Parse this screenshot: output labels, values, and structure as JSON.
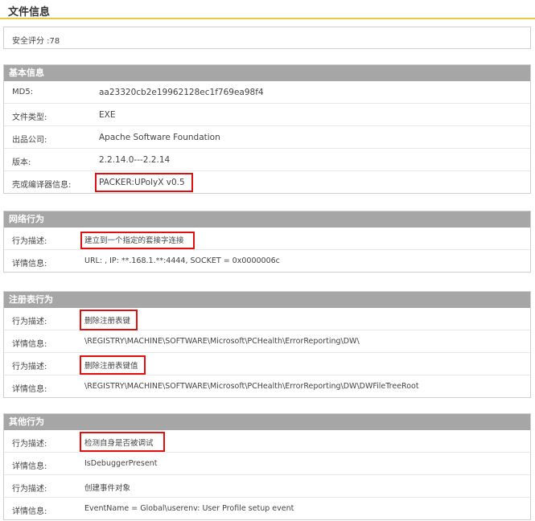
{
  "header": {
    "title": "文件信息"
  },
  "score": {
    "text": "安全评分 :78"
  },
  "basic": {
    "title": "基本信息",
    "rows": [
      {
        "label": "MD5:",
        "value": "aa23320cb2e19962128ec1f769ea98f4"
      },
      {
        "label": "文件类型:",
        "value": "EXE"
      },
      {
        "label": "出品公司:",
        "value": "Apache Software Foundation"
      },
      {
        "label": "版本:",
        "value": "2.2.14.0---2.2.14"
      },
      {
        "label": "壳或编译器信息:",
        "value": "PACKER:UPolyX v0.5"
      }
    ]
  },
  "network": {
    "title": "网络行为",
    "rows": [
      {
        "label": "行为描述:",
        "value": "建立到一个指定的套接字连接"
      },
      {
        "label": "详情信息:",
        "value": "URL: , IP: **.168.1.**:4444, SOCKET = 0x0000006c"
      }
    ]
  },
  "registry": {
    "title": "注册表行为",
    "rows": [
      {
        "label": "行为描述:",
        "value": "删除注册表键"
      },
      {
        "label": "详情信息:",
        "value": "\\REGISTRY\\MACHINE\\SOFTWARE\\Microsoft\\PCHealth\\ErrorReporting\\DW\\"
      },
      {
        "label": "行为描述:",
        "value": "删除注册表键值"
      },
      {
        "label": "详情信息:",
        "value": "\\REGISTRY\\MACHINE\\SOFTWARE\\Microsoft\\PCHealth\\ErrorReporting\\DW\\DWFileTreeRoot"
      }
    ]
  },
  "other": {
    "title": "其他行为",
    "rows": [
      {
        "label": "行为描述:",
        "value": "检测自身是否被调试"
      },
      {
        "label": "详情信息:",
        "value": "IsDebuggerPresent"
      },
      {
        "label": "行为描述:",
        "value": "创建事件对象"
      },
      {
        "label": "详情信息:",
        "value": "EventName = Global\\userenv: User Profile setup event"
      }
    ]
  },
  "colors": {
    "section_header": "#a6a6a6",
    "accent_line": "#e6c84a",
    "highlight": "#e01010"
  }
}
